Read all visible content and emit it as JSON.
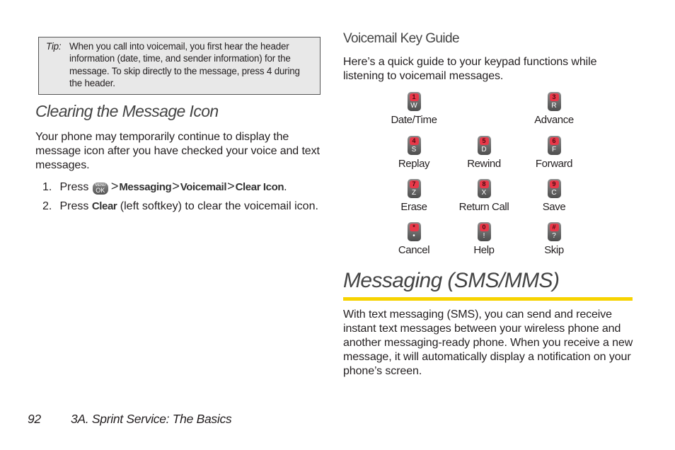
{
  "tip": {
    "label": "Tip:",
    "text": "When you call into voicemail, you first hear the header information (date, time, and sender information) for the message. To skip directly to the message, press 4 during the header."
  },
  "clearing": {
    "heading": "Clearing the Message Icon",
    "paragraph": "Your phone may temporarily continue to display the message icon after you have checked your voice and text messages.",
    "steps": [
      {
        "num": "1.",
        "prefix": "Press",
        "key_icon": "menu-ok-key-icon",
        "key_top": "MENU",
        "key_bottom": "OK",
        "path": [
          "Messaging",
          "Voicemail",
          "Clear Icon"
        ],
        "separator": ">",
        "suffix": "."
      },
      {
        "num": "2.",
        "prefix": "Press",
        "bold": "Clear",
        "suffix": "(left softkey) to clear the voicemail icon."
      }
    ]
  },
  "voicemail_guide": {
    "heading": "Voicemail Key Guide",
    "paragraph": "Here’s a quick guide to your keypad functions while listening to voicemail messages.",
    "keys": [
      {
        "num": "1",
        "letter": "W",
        "label": "Date/Time"
      },
      {
        "num": "3",
        "letter": "R",
        "label": "Advance"
      },
      {
        "num": "4",
        "letter": "S",
        "label": "Replay"
      },
      {
        "num": "5",
        "letter": "D",
        "label": "Rewind"
      },
      {
        "num": "6",
        "letter": "F",
        "label": "Forward"
      },
      {
        "num": "7",
        "letter": "Z",
        "label": "Erase"
      },
      {
        "num": "8",
        "letter": "X",
        "label": "Return Call"
      },
      {
        "num": "9",
        "letter": "C",
        "label": "Save"
      },
      {
        "num": "*",
        "letter": "•",
        "label": "Cancel"
      },
      {
        "num": "0",
        "letter": "!",
        "label": "Help"
      },
      {
        "num": "#",
        "letter": "?",
        "label": "Skip"
      }
    ],
    "key_colors": {
      "body": "#6b6b6b",
      "number_pad": "#e8394a"
    }
  },
  "messaging": {
    "heading": "Messaging (SMS/MMS)",
    "rule_color": "#f7d300",
    "paragraph": "With text messaging (SMS), you can send and receive instant text messages between your wireless phone and another messaging-ready phone. When you receive a new message, it will automatically display a notification on your phone’s screen."
  },
  "footer": {
    "page_number": "92",
    "chapter": "3A. Sprint Service: The Basics"
  }
}
